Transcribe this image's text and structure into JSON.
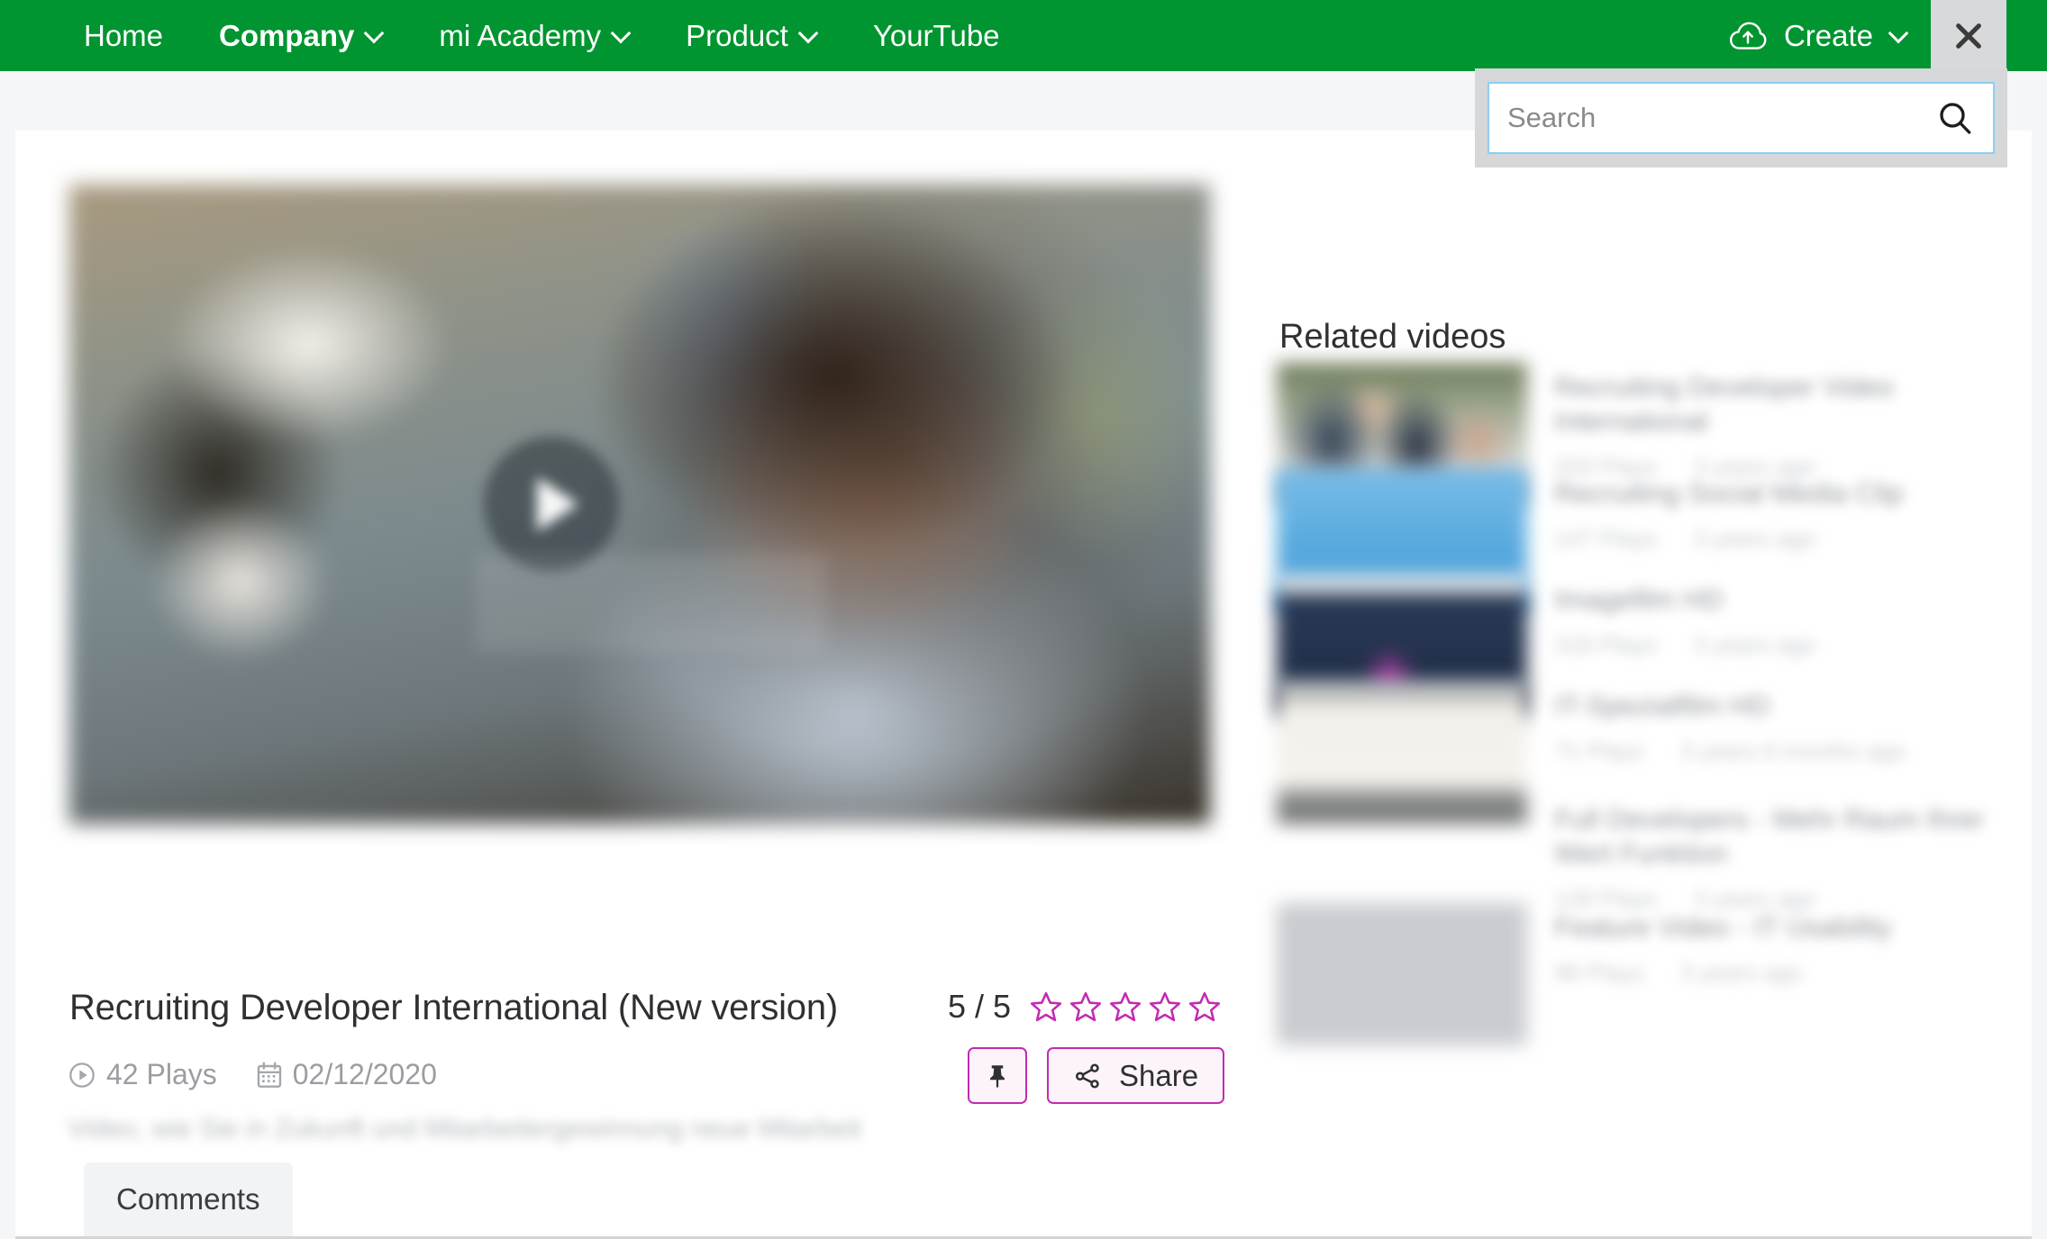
{
  "topnav": {
    "background_color": "#009530",
    "items": [
      {
        "label": "Home",
        "has_caret": false,
        "bold": false
      },
      {
        "label": "Company",
        "has_caret": true,
        "bold": true
      },
      {
        "label": "mi Academy",
        "has_caret": true,
        "bold": false
      },
      {
        "label": "Product",
        "has_caret": true,
        "bold": false
      },
      {
        "label": "YourTube",
        "has_caret": false,
        "bold": false
      }
    ],
    "create": {
      "label": "Create",
      "icon": "cloud-upload-icon",
      "has_caret": true
    },
    "close": {
      "icon": "close-icon"
    }
  },
  "search": {
    "placeholder": "Search",
    "value": "",
    "icon": "search-icon",
    "panel_background": "#d5d7d9",
    "focus_border_color": "#8ecdf2"
  },
  "video": {
    "title": "Recruiting Developer International (New version)",
    "plays": "42 Plays",
    "plays_icon": "play-circle-icon",
    "date": "02/12/2020",
    "date_icon": "calendar-icon",
    "description": "Video, wie Sie in Zukunft und Mitarbeitergewinnung neue Mitarbeiter",
    "play_button_icon": "play-icon"
  },
  "rating": {
    "value": "5 / 5",
    "stars_total": 5,
    "stars_filled": 0,
    "star_color": "#c32bb2"
  },
  "actions": {
    "pin": {
      "label": "",
      "icon": "pin-icon"
    },
    "share": {
      "label": "Share",
      "icon": "share-icon"
    },
    "accent_color": "#c32bb2",
    "fill_color": "#fdf4fb"
  },
  "tabs": [
    {
      "label": "Comments",
      "active": true
    }
  ],
  "related": {
    "heading": "Related videos",
    "items": [
      {
        "title": "Recruiting Developer Video International",
        "plays": "203 Plays",
        "age": "3 years ago",
        "thumb_colors": [
          "#6d7a58",
          "#2d3d52",
          "#dcd3c3",
          "#e8ecf1"
        ],
        "thumb_kind": "two-people-office"
      },
      {
        "title": "Recruiting Social Media Clip",
        "plays": "147 Plays",
        "age": "3 years ago",
        "thumb_colors": [
          "#69b2e3",
          "#3f9ddb",
          "#b9d77a",
          "#e6f1fa"
        ],
        "thumb_kind": "blue-slide"
      },
      {
        "title": "Imagefilm HD",
        "plays": "318 Plays",
        "age": "3 years ago",
        "thumb_colors": [
          "#2a3a57",
          "#1d2a42",
          "#c03fb0",
          "#f0f1f3"
        ],
        "thumb_kind": "dark-slide"
      },
      {
        "title": "IT-Spezialfilm HD",
        "plays": "71 Plays",
        "age": "3 years 6 months ago",
        "thumb_colors": [
          "#f1efe9",
          "#8d8f8f",
          "#5c5e5e",
          "#ffffff"
        ],
        "thumb_kind": "monitor-document"
      },
      {
        "title": "Full Developers - Mehr Raum Ihrer Wert Funktion",
        "plays": "128 Plays",
        "age": "3 years ago",
        "thumb_colors": [
          "#ffffff",
          "#f6f6f6",
          "#dddddd",
          "#ffffff"
        ],
        "thumb_kind": "blank-white"
      },
      {
        "title": "Feature Video - IT Usability",
        "plays": "96 Plays",
        "age": "3 years ago",
        "thumb_colors": [
          "#d9cfc0",
          "#8fd14a",
          "#f0a6b9",
          "#1a1a1a"
        ],
        "thumb_kind": "green-bike"
      }
    ]
  }
}
